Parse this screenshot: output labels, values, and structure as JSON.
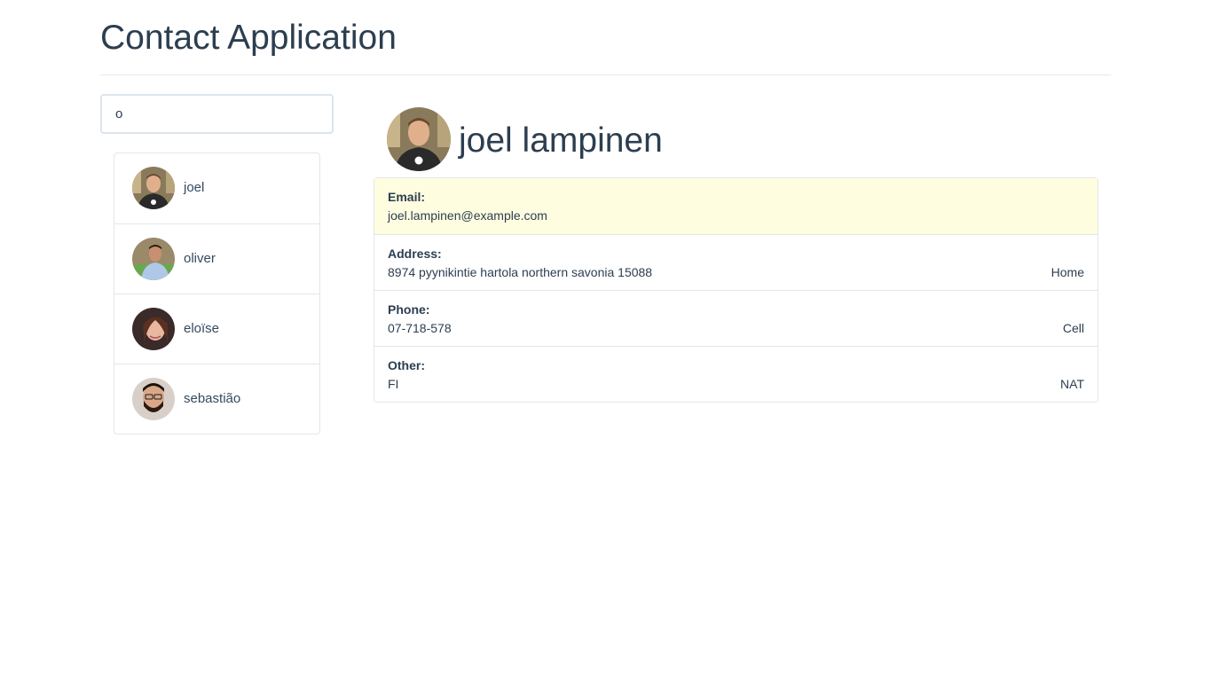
{
  "header": {
    "title": "Contact Application"
  },
  "search": {
    "value": "o",
    "placeholder": ""
  },
  "contacts": [
    {
      "name": "joel",
      "avatar": "avatar-joel"
    },
    {
      "name": "oliver",
      "avatar": "avatar-oliver"
    },
    {
      "name": "eloïse",
      "avatar": "avatar-eloise"
    },
    {
      "name": "sebastião",
      "avatar": "avatar-sebastiao"
    }
  ],
  "detail": {
    "full_name": "joel lampinen",
    "fields": [
      {
        "label": "Email:",
        "value": "joel.lampinen@example.com",
        "tag": ""
      },
      {
        "label": "Address:",
        "value": "8974 pyynikintie hartola northern savonia 15088",
        "tag": "Home"
      },
      {
        "label": "Phone:",
        "value": "07-718-578",
        "tag": "Cell"
      },
      {
        "label": "Other:",
        "value": "FI",
        "tag": "NAT"
      }
    ]
  },
  "colors": {
    "text": "#2c3e50",
    "highlight_row": "#fefde0",
    "border": "#e3e6e8",
    "input_border": "#dce4ec"
  }
}
